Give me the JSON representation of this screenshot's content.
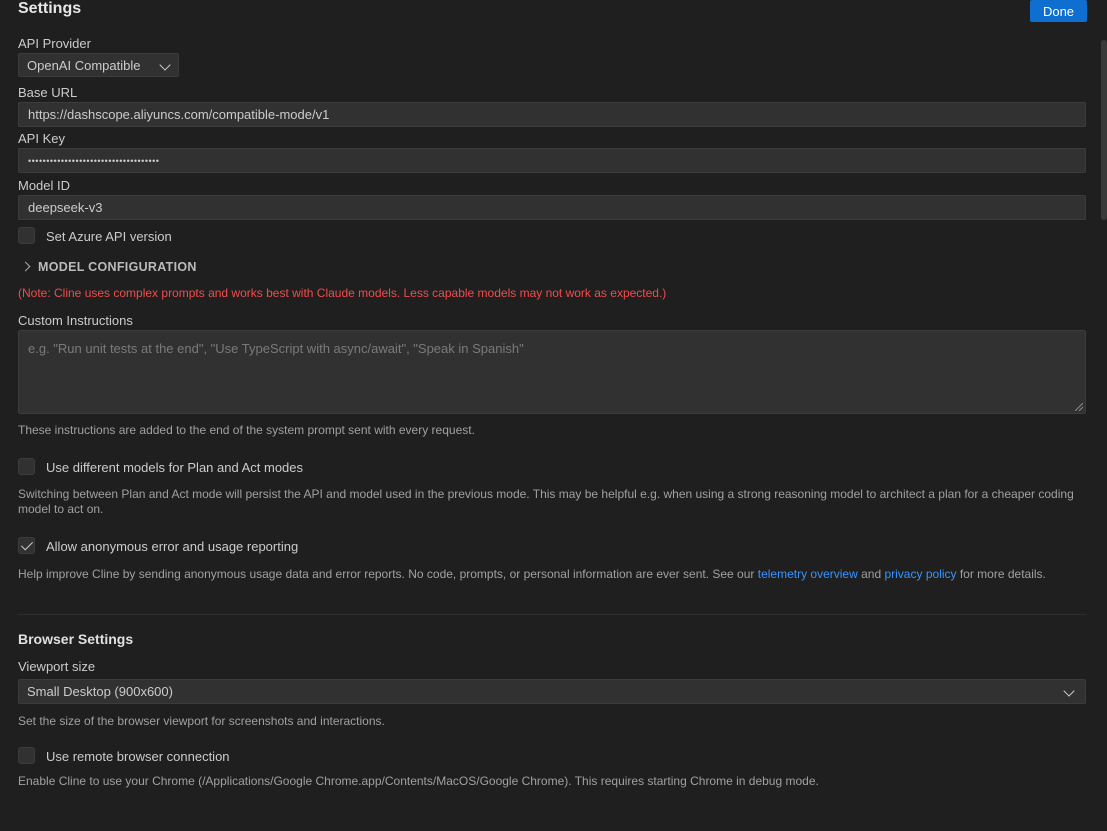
{
  "header": {
    "title": "Settings",
    "done_label": "Done"
  },
  "api": {
    "provider_label": "API Provider",
    "provider_value": "OpenAI Compatible",
    "base_url_label": "Base URL",
    "base_url_value": "https://dashscope.aliyuncs.com/compatible-mode/v1",
    "api_key_label": "API Key",
    "api_key_value": "••••••••••••••••••••••••••••••••••••",
    "model_id_label": "Model ID",
    "model_id_value": "deepseek-v3",
    "azure_label": "Set Azure API version",
    "azure_checked": false,
    "model_config_label": "MODEL CONFIGURATION",
    "note": "(Note: Cline uses complex prompts and works best with Claude models. Less capable models may not work as expected.)"
  },
  "custom": {
    "label": "Custom Instructions",
    "placeholder": "e.g. \"Run unit tests at the end\", \"Use TypeScript with async/await\", \"Speak in Spanish\"",
    "desc": "These instructions are added to the end of the system prompt sent with every request."
  },
  "plan_act": {
    "label": "Use different models for Plan and Act modes",
    "checked": false,
    "desc": "Switching between Plan and Act mode will persist the API and model used in the previous mode. This may be helpful e.g. when using a strong reasoning model to architect a plan for a cheaper coding model to act on."
  },
  "telemetry": {
    "label": "Allow anonymous error and usage reporting",
    "checked": true,
    "desc_pre": "Help improve Cline by sending anonymous usage data and error reports. No code, prompts, or personal information are ever sent. See our ",
    "link1": "telemetry overview",
    "desc_mid": " and ",
    "link2": "privacy policy",
    "desc_post": " for more details."
  },
  "browser": {
    "title": "Browser Settings",
    "viewport_label": "Viewport size",
    "viewport_value": "Small Desktop (900x600)",
    "viewport_desc": "Set the size of the browser viewport for screenshots and interactions.",
    "remote_label": "Use remote browser connection",
    "remote_checked": false,
    "remote_desc": "Enable Cline to use your Chrome (/Applications/Google Chrome.app/Contents/MacOS/Google Chrome). This requires starting Chrome in debug mode."
  },
  "colors": {
    "accent": "#0e6fd1",
    "link": "#3794ff",
    "note": "#f14c4c",
    "background": "#1f1f1f"
  }
}
